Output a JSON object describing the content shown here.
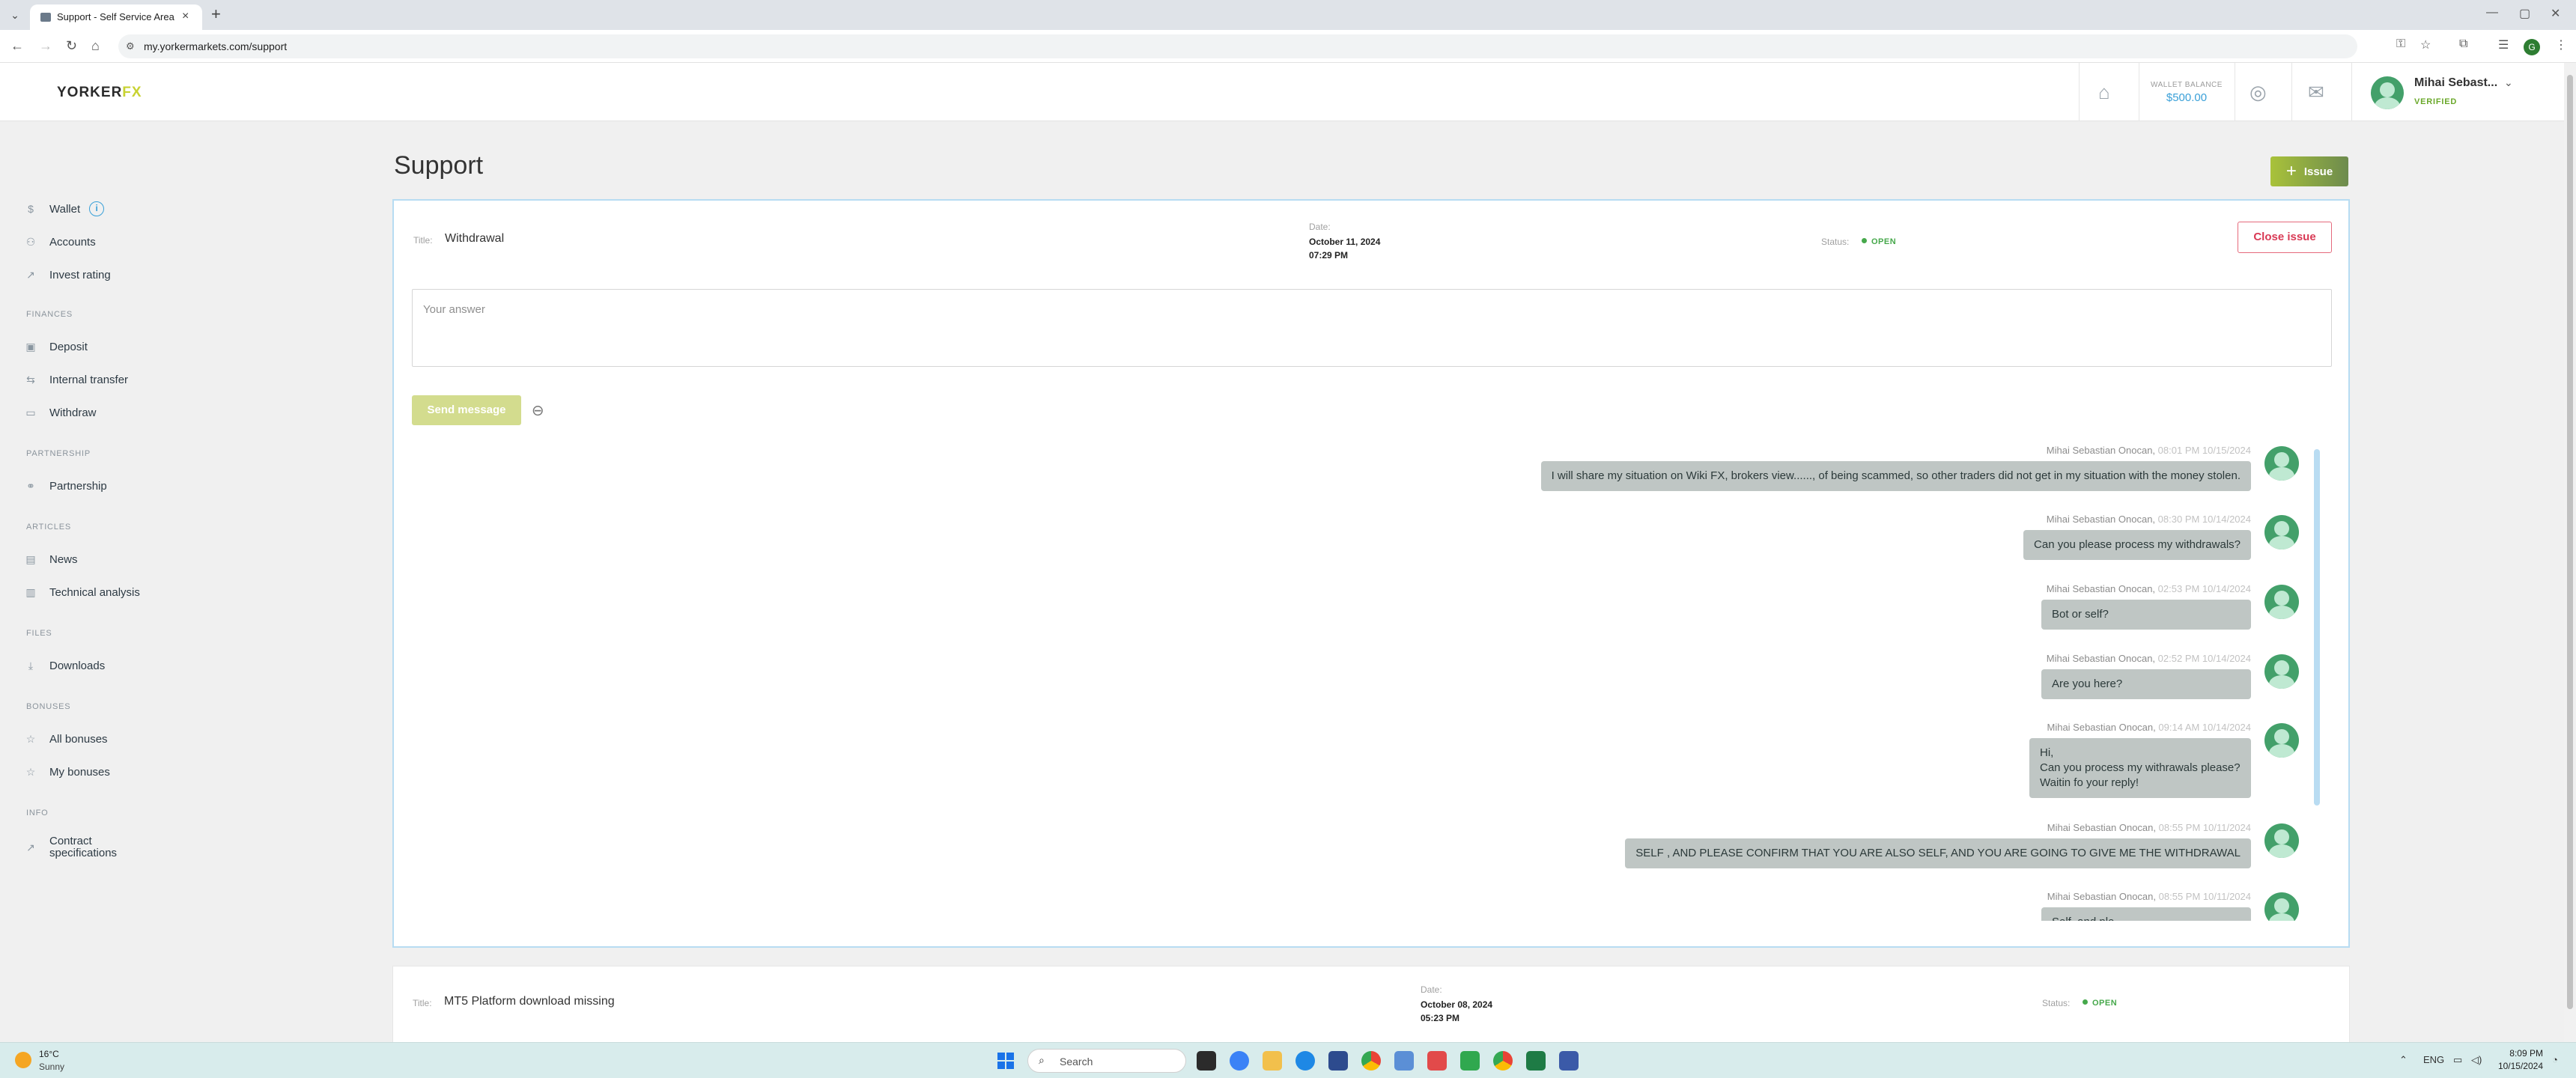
{
  "browser": {
    "tab_title": "Support - Self Service Area | Yo",
    "url": "my.yorkermarkets.com/support"
  },
  "header": {
    "logo_main": "YORKER",
    "logo_accent": "FX",
    "wallet_label": "WALLET BALANCE",
    "wallet_value": "$500.00",
    "user_name": "Mihai Sebast...",
    "user_status": "VERIFIED"
  },
  "sidebar": {
    "items": [
      {
        "label": "Wallet"
      },
      {
        "label": "Accounts"
      },
      {
        "label": "Invest rating"
      },
      {
        "label": "Deposit"
      },
      {
        "label": "Internal transfer"
      },
      {
        "label": "Withdraw"
      },
      {
        "label": "Partnership"
      },
      {
        "label": "News"
      },
      {
        "label": "Technical analysis"
      },
      {
        "label": "Downloads"
      },
      {
        "label": "All bonuses"
      },
      {
        "label": "My bonuses"
      },
      {
        "label": "Contract"
      },
      {
        "label": "specifications"
      }
    ],
    "sections": [
      "FINANCES",
      "PARTNERSHIP",
      "ARTICLES",
      "FILES",
      "BONUSES",
      "INFO"
    ]
  },
  "page": {
    "title": "Support",
    "issue_button": "Issue"
  },
  "ticket": {
    "title_label": "Title:",
    "title": "Withdrawal",
    "date_label": "Date:",
    "date": "October 11, 2024",
    "time": "07:29 PM",
    "status_label": "Status:",
    "status": "OPEN",
    "close_button": "Close issue",
    "answer_placeholder": "Your answer",
    "send_button": "Send message",
    "messages": [
      {
        "author": "Mihai Sebastian Onocan,",
        "time": "08:01 PM 10/15/2024",
        "lines": [
          "I will share my situation on Wiki FX, brokers view......, of being scammed, so other traders did not get in my situation with the money stolen."
        ]
      },
      {
        "author": "Mihai Sebastian Onocan,",
        "time": "08:30 PM 10/14/2024",
        "lines": [
          "Can you please process my withdrawals?"
        ]
      },
      {
        "author": "Mihai Sebastian Onocan,",
        "time": "02:53 PM 10/14/2024",
        "lines": [
          "Bot or self?"
        ]
      },
      {
        "author": "Mihai Sebastian Onocan,",
        "time": "02:52 PM 10/14/2024",
        "lines": [
          "Are you here?"
        ]
      },
      {
        "author": "Mihai Sebastian Onocan,",
        "time": "09:14 AM 10/14/2024",
        "lines": [
          "Hi,",
          "Can you process my withrawals please?",
          "Waitin fo your reply!"
        ]
      },
      {
        "author": "Mihai Sebastian Onocan,",
        "time": "08:55 PM 10/11/2024",
        "lines": [
          "SELF , AND PLEASE CONFIRM THAT YOU ARE ALSO SELF, AND YOU ARE GOING TO GIVE ME THE WITHDRAWAL"
        ]
      },
      {
        "author": "Mihai Sebastian Onocan,",
        "time": "08:55 PM 10/11/2024",
        "lines": [
          "Self, and ple"
        ]
      }
    ]
  },
  "ticket2": {
    "title_label": "Title:",
    "title": "MT5 Platform download missing",
    "date_label": "Date:",
    "date": "October 08, 2024",
    "time": "05:23 PM",
    "status_label": "Status:",
    "status": "OPEN"
  },
  "taskbar": {
    "temp": "16°C",
    "weather": "Sunny",
    "search": "Search",
    "lang": "ENG",
    "time": "8:09 PM",
    "date": "10/15/2024"
  },
  "colors": {
    "accent_blue": "#3aa0d8",
    "status_green": "#46a84b",
    "issue_btn_start": "#a9c23a",
    "close_red": "#d93a55",
    "bubble_gray": "#bfc6c4"
  }
}
